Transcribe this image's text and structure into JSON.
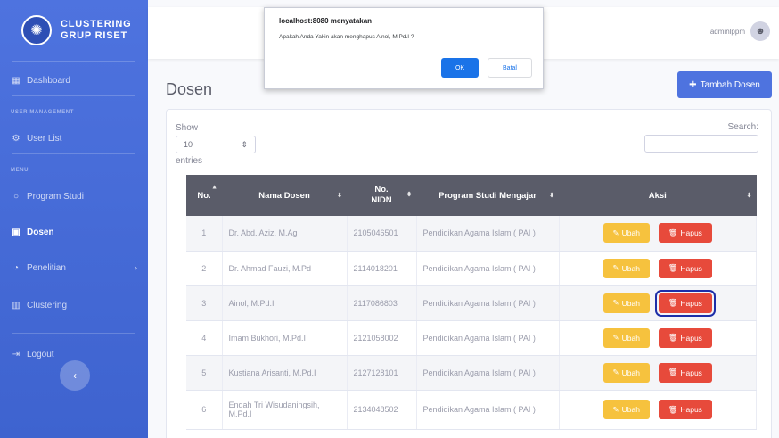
{
  "brand": {
    "line1": "CLUSTERING",
    "line2": "GRUP RISET",
    "icon": "brain-icon"
  },
  "sidebar": {
    "dashboard": "Dashboard",
    "heading_user": "USER MANAGEMENT",
    "user_list": "User List",
    "heading_menu": "MENU",
    "program_studi": "Program Studi",
    "dosen": "Dosen",
    "penelitian": "Penelitian",
    "clustering": "Clustering",
    "logout": "Logout"
  },
  "topbar": {
    "username": "adminlppm"
  },
  "page": {
    "title": "Dosen",
    "add_button": "Tambah Dosen"
  },
  "table_controls": {
    "show": "Show",
    "entries_value": "10",
    "entries": "entries",
    "search": "Search:"
  },
  "table": {
    "headers": {
      "no": "No.",
      "nama": "Nama Dosen",
      "nidn_top": "No.",
      "nidn_bottom": "NIDN",
      "prodi": "Program Studi Mengajar",
      "aksi": "Aksi"
    },
    "ubah_label": "Ubah",
    "hapus_label": "Hapus",
    "rows": [
      {
        "no": "1",
        "nama": "Dr. Abd. Aziz, M.Ag",
        "nidn": "2105046501",
        "prodi": "Pendidikan Agama Islam ( PAI )"
      },
      {
        "no": "2",
        "nama": "Dr. Ahmad Fauzi, M.Pd",
        "nidn": "2114018201",
        "prodi": "Pendidikan Agama Islam ( PAI )"
      },
      {
        "no": "3",
        "nama": "Ainol, M.Pd.I",
        "nidn": "2117086803",
        "prodi": "Pendidikan Agama Islam ( PAI )"
      },
      {
        "no": "4",
        "nama": "Imam Bukhori, M.Pd.I",
        "nidn": "2121058002",
        "prodi": "Pendidikan Agama Islam ( PAI )"
      },
      {
        "no": "5",
        "nama": "Kustiana Arisanti, M.Pd.I",
        "nidn": "2127128101",
        "prodi": "Pendidikan Agama Islam ( PAI )"
      },
      {
        "no": "6",
        "nama": "Endah Tri Wisudaningsih, M.Pd.I",
        "nidn": "2134048502",
        "prodi": "Pendidikan Agama Islam ( PAI )"
      }
    ]
  },
  "dialog": {
    "title": "localhost:8080 menyatakan",
    "message": "Apakah Anda Yakin akan menghapus Ainol, M.Pd.I ?",
    "ok": "OK",
    "cancel": "Batal"
  },
  "colors": {
    "primary": "#4e73df",
    "warning": "#f6c23e",
    "danger": "#e74a3b",
    "header": "#5a5c69"
  }
}
